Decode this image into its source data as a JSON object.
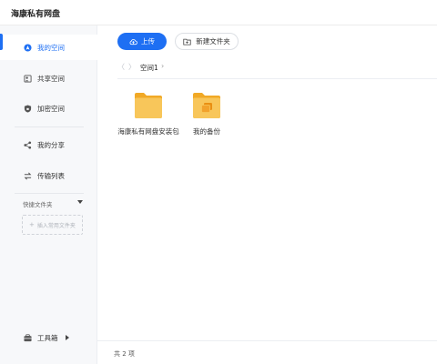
{
  "app": {
    "title": "海康私有网盘"
  },
  "sidebar": {
    "items": [
      {
        "label": "我的空间",
        "icon": "my-space-icon",
        "active": true
      },
      {
        "label": "共享空间",
        "icon": "shared-space-icon",
        "active": false
      },
      {
        "label": "加密空间",
        "icon": "encrypted-space-icon",
        "active": false
      },
      {
        "label": "我的分享",
        "icon": "share-icon",
        "active": false
      },
      {
        "label": "传输列表",
        "icon": "transfer-icon",
        "active": false
      }
    ],
    "quick_folders": {
      "title": "快捷文件夹",
      "add_label": "插入常用文件夹"
    },
    "toolbox": {
      "label": "工具箱"
    }
  },
  "toolbar": {
    "upload_label": "上传",
    "new_folder_label": "新建文件夹"
  },
  "breadcrumb": {
    "back": "〈",
    "forward": "〉",
    "current": "空间1",
    "separator": "›"
  },
  "files": [
    {
      "name": "海康私有网盘安装包",
      "type": "folder"
    },
    {
      "name": "我的备份",
      "type": "backup-folder"
    }
  ],
  "status": {
    "count_text": "共 2 项"
  },
  "colors": {
    "accent": "#1e6ff3",
    "folder": "#f8c65a",
    "folder_dark": "#f1a926"
  }
}
